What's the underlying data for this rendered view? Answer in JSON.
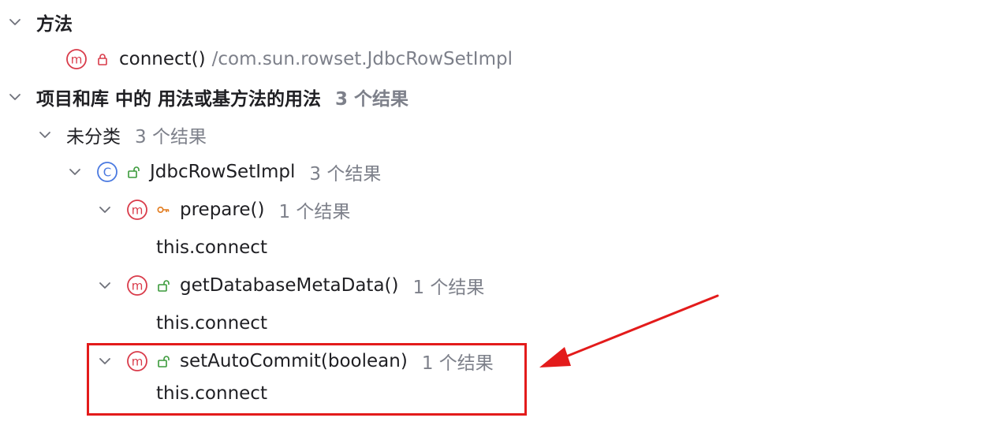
{
  "tree": {
    "section_methods": {
      "label": "方法"
    },
    "method_connect": {
      "name": "connect()",
      "path": "/com.sun.rowset.JdbcRowSetImpl"
    },
    "section_usages": {
      "label": "项目和库 中的 用法或基方法的用法",
      "count": "3 个结果"
    },
    "uncategorized": {
      "label": "未分类",
      "count": "3 个结果"
    },
    "class_node": {
      "name": "JdbcRowSetImpl",
      "count": "3 个结果"
    },
    "usages": [
      {
        "method": "prepare()",
        "count": "1 个结果",
        "code": "this.connect"
      },
      {
        "method": "getDatabaseMetaData()",
        "count": "1 个结果",
        "code": "this.connect"
      },
      {
        "method": "setAutoCommit(boolean)",
        "count": "1 个结果",
        "code": "this.connect"
      }
    ]
  },
  "colors": {
    "method_icon": "#d93b4a",
    "class_icon": "#4a79e0",
    "lock_private": "#d93b4a",
    "lock_public": "#3a9a3a",
    "key_protected": "#e27a1c",
    "selection_bg": "#e5e6ea",
    "annotation_red": "#e31b1b"
  }
}
